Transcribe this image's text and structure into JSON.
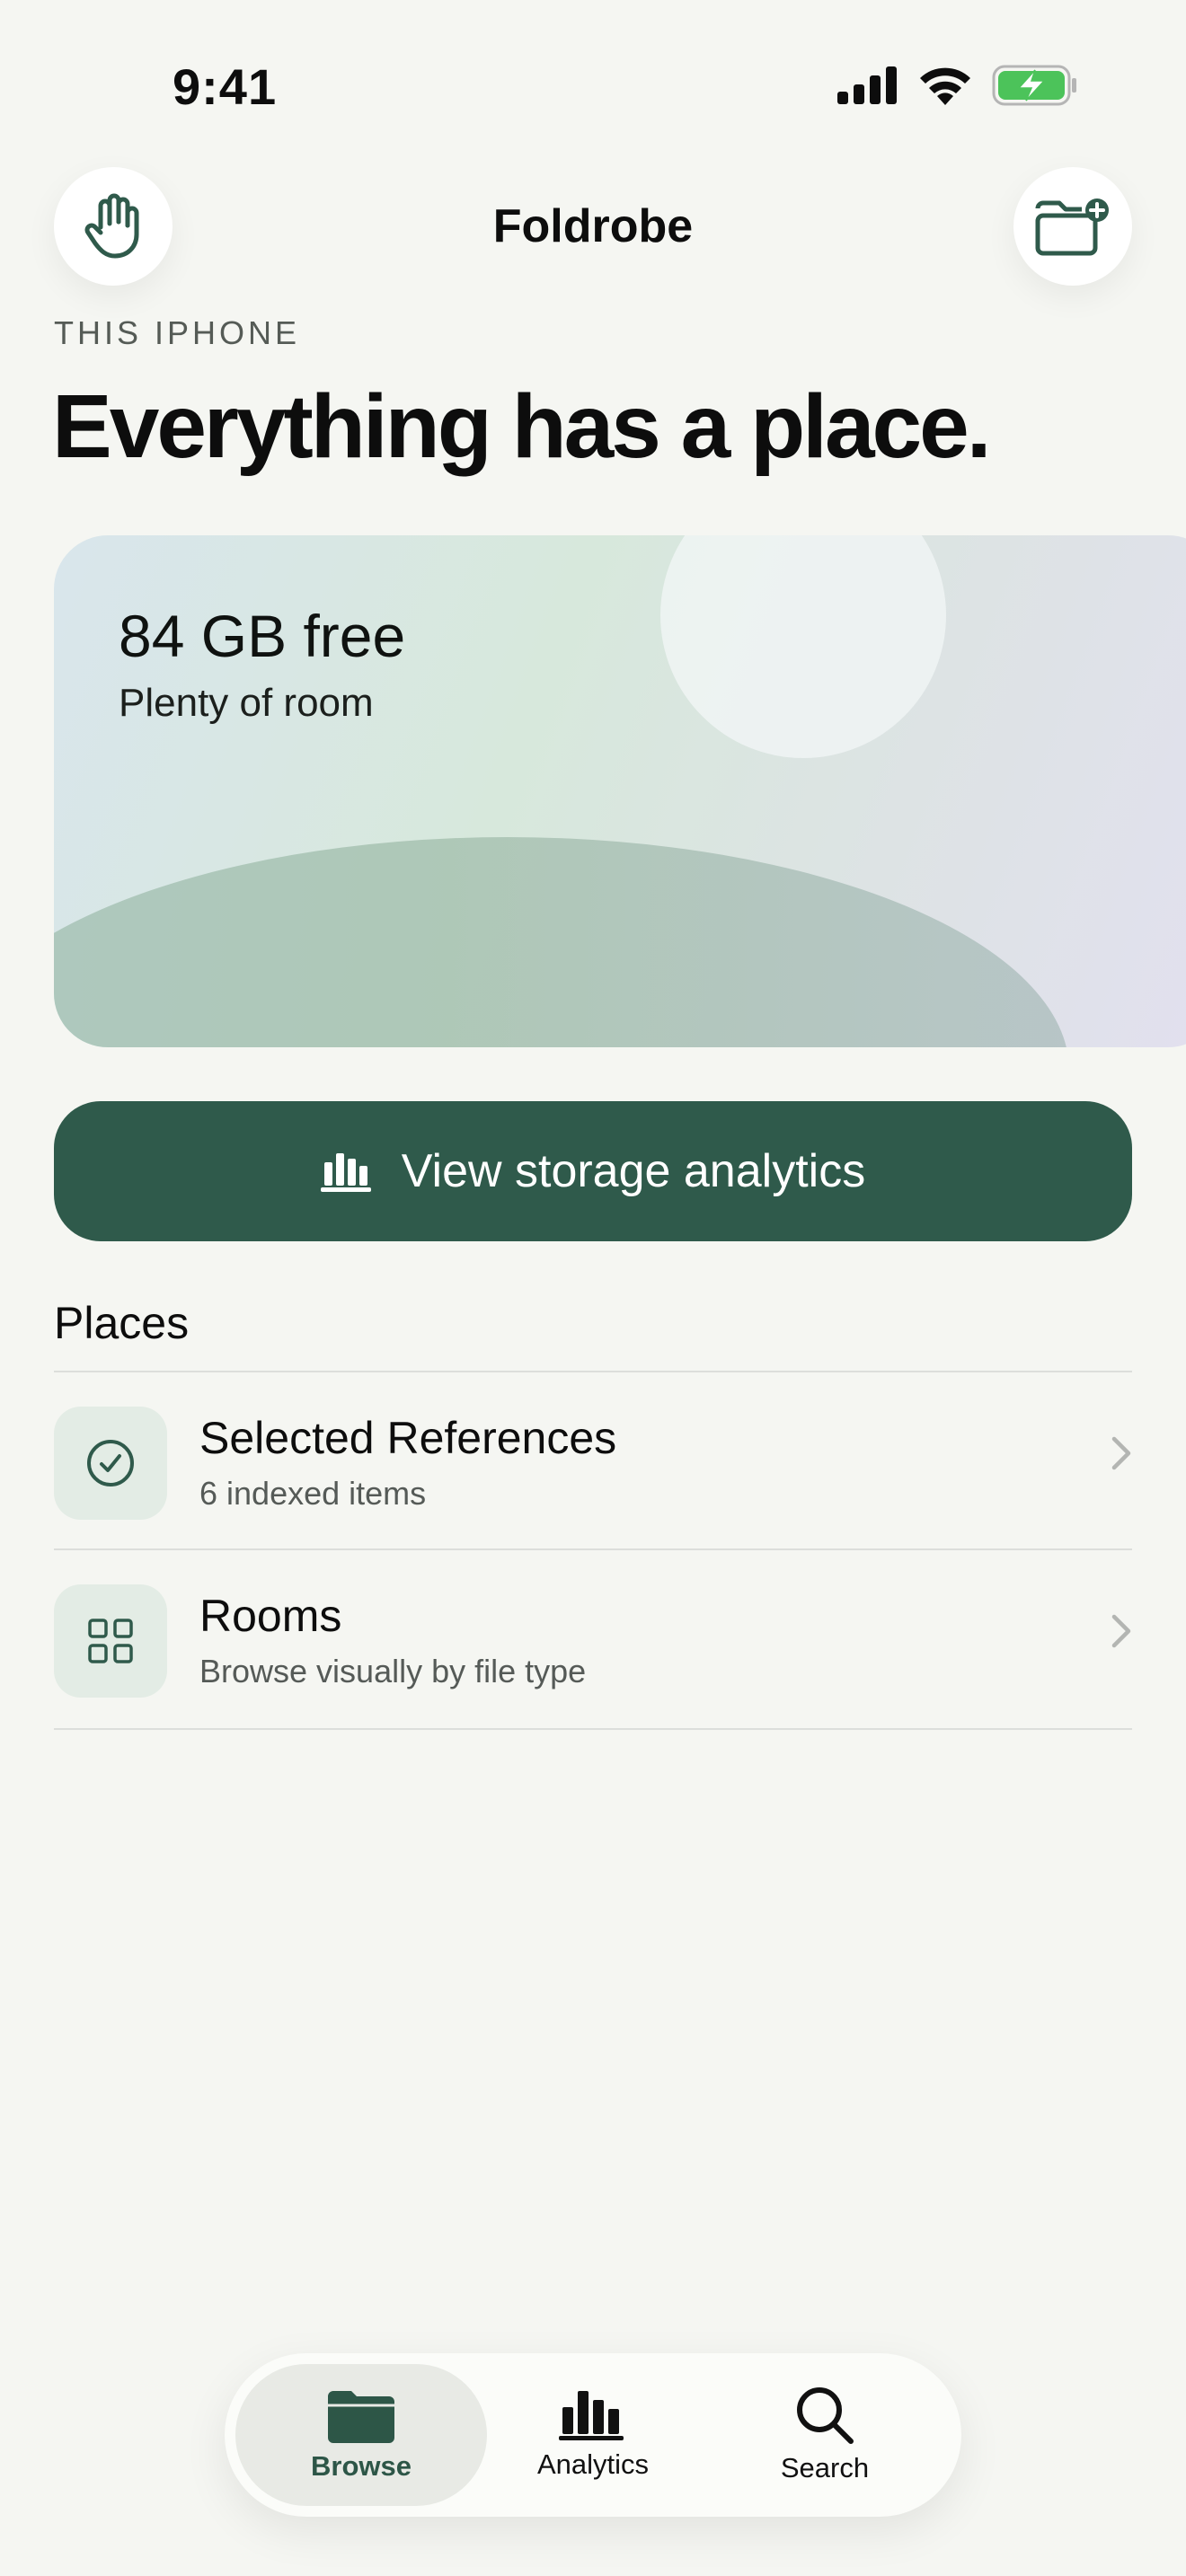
{
  "status_bar": {
    "time": "9:41"
  },
  "nav": {
    "title": "Foldrobe"
  },
  "header": {
    "eyebrow": "THIS IPHONE",
    "headline": "Everything has a place."
  },
  "storage": {
    "free_label": "84 GB free",
    "subtitle": "Plenty of room"
  },
  "analytics_button": {
    "label": "View storage analytics"
  },
  "places": {
    "title": "Places",
    "items": [
      {
        "title": "Selected References",
        "subtitle": "6 indexed items",
        "icon": "check-circle-icon"
      },
      {
        "title": "Rooms",
        "subtitle": "Browse visually by file type",
        "icon": "grid-icon"
      }
    ]
  },
  "tabbar": {
    "tabs": [
      {
        "label": "Browse",
        "icon": "folder-icon",
        "active": true
      },
      {
        "label": "Analytics",
        "icon": "bar-chart-icon",
        "active": false
      },
      {
        "label": "Search",
        "icon": "search-icon",
        "active": false
      }
    ]
  },
  "colors": {
    "accent": "#2f5a4b",
    "background": "#f5f6f2",
    "battery": "#4cc35a"
  }
}
